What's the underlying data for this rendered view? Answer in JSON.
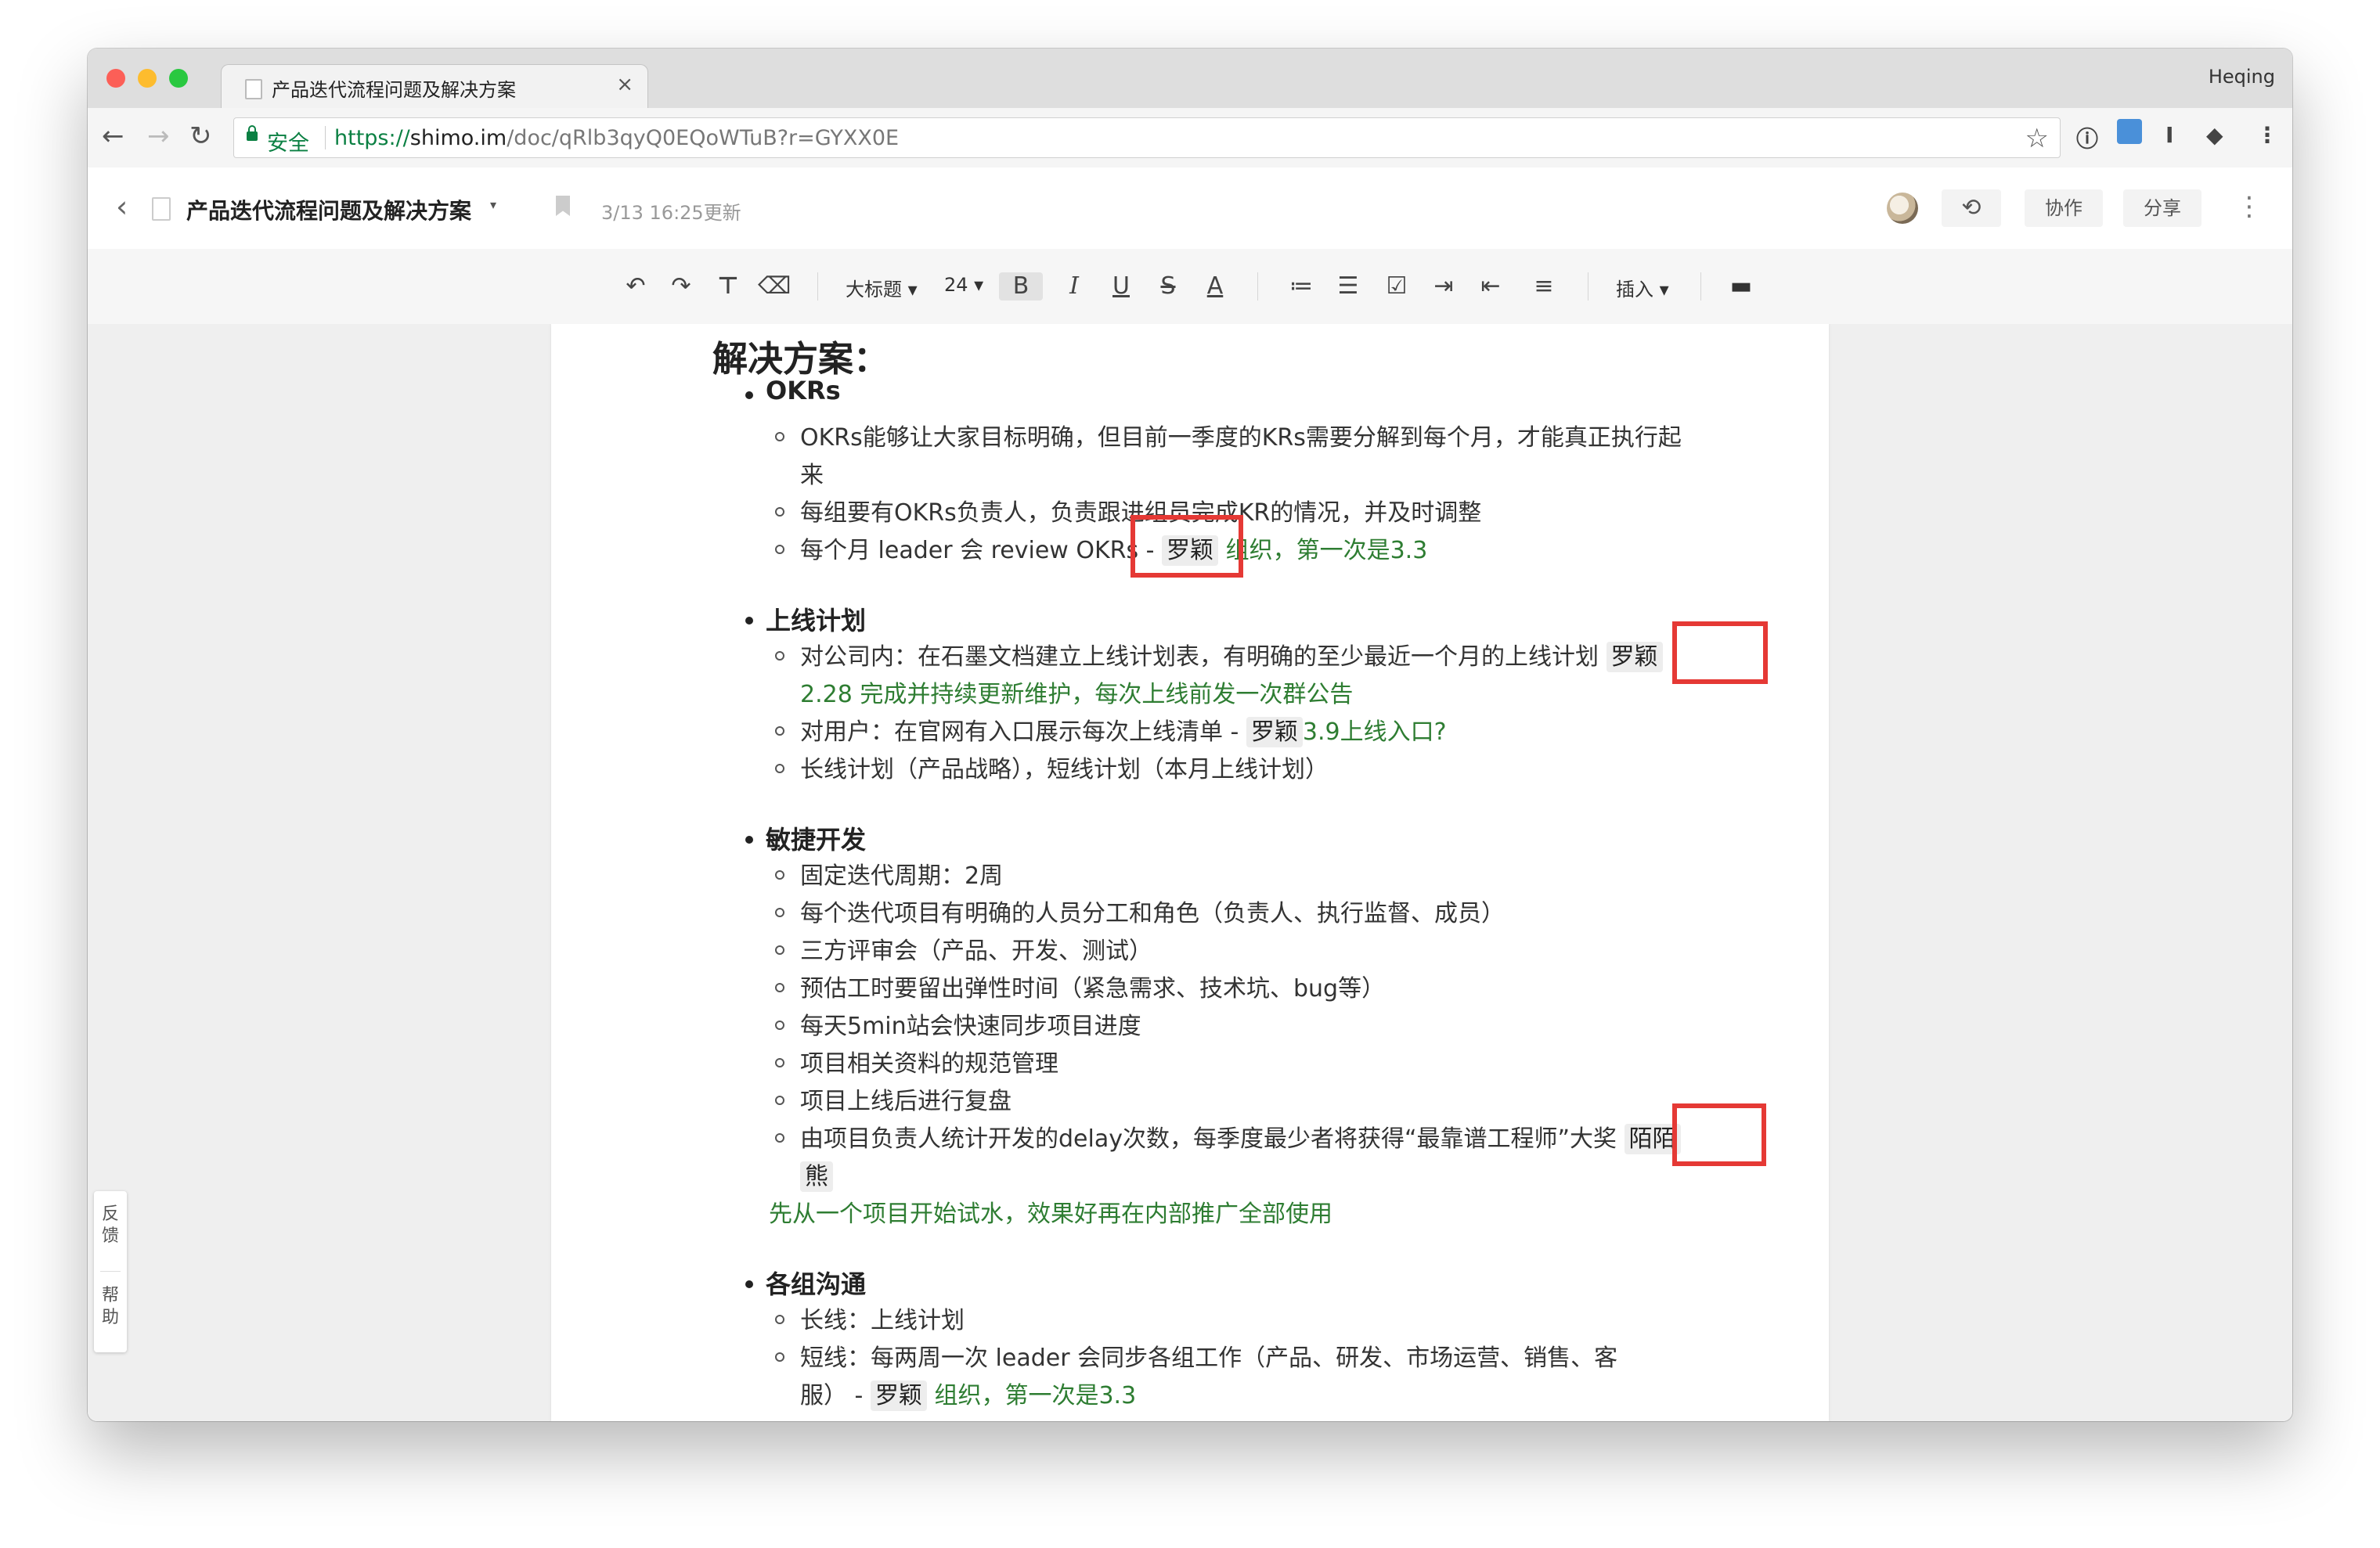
{
  "browser": {
    "tab_title": "产品迭代流程问题及解决方案",
    "tab_close": "×",
    "profile_name": "Heqing",
    "secure_label": "安全",
    "url_proto": "https://",
    "url_host": "shimo.im",
    "url_path": "/doc/qRlb3qyQ0EQoWTuB?r=GYXX0E",
    "back_icon": "←",
    "forward_icon": "→",
    "reload_icon": "↻",
    "star_icon": "☆"
  },
  "app": {
    "back_icon": "‹",
    "doc_title": "产品迭代流程问题及解决方案",
    "title_caret": "▾",
    "updated": "3/13 16:25更新",
    "history_icon": "⟲",
    "collaborate_label": "协作",
    "share_label": "分享",
    "more_icon": "⋮"
  },
  "toolbar": {
    "undo": "↶",
    "redo": "↷",
    "format_painter": "⊤",
    "clear_format": "⌫",
    "heading_style": "大标题 ▾",
    "font_size": "24 ▾",
    "bold": "B",
    "italic": "I",
    "underline": "U",
    "strike": "S",
    "font_color": "A",
    "ordered_list": "≔",
    "bullet_list": "☰",
    "checklist": "☑",
    "indent": "⇥",
    "outdent": "⇤",
    "align": "≡",
    "insert": "插入 ▾",
    "comment": "▬"
  },
  "doc": {
    "heading": "解决方案：",
    "sections": [
      {
        "title": "OKRs",
        "items": [
          "OKRs能够让大家目标明确，但目前一季度的KRs需要分解到每个月，才能真正执行起",
          "来",
          "每组要有OKRs负责人，负责跟进组员完成KR的情况，并及时调整",
          "每个月 leader 会 review OKRs - ",
          "罗颖",
          " 组织，第一次是3.3"
        ]
      },
      {
        "title": "上线计划",
        "items": [
          "对公司内：在石墨文档建立上线计划表，有明确的至少最近一个月的上线计划 ",
          "罗颖",
          "2.28 完成并持续更新维护，每次上线前发一次群公告",
          "对用户：在官网有入口展示每次上线清单 - ",
          "罗颖",
          "3.9上线入口?",
          "长线计划（产品战略），短线计划（本月上线计划）"
        ]
      },
      {
        "title": "敏捷开发",
        "items": [
          "固定迭代周期：2周",
          "每个迭代项目有明确的人员分工和角色（负责人、执行监督、成员）",
          "三方评审会（产品、开发、测试）",
          "预估工时要留出弹性时间（紧急需求、技术坑、bug等）",
          "每天5min站会快速同步项目进度",
          "项目相关资料的规范管理",
          "项目上线后进行复盘",
          "由项目负责人统计开发的delay次数，每季度最少者将获得“最靠谱工程师”大奖 ",
          "陌陌",
          "熊",
          "先从一个项目开始试水，效果好再在内部推广全部使用"
        ]
      },
      {
        "title": "各组沟通",
        "items": [
          "长线：上线计划",
          "短线：每两周一次 leader 会同步各组工作（产品、研发、市场运营、销售、客",
          "服） - ",
          "罗颖",
          " 组织，第一次是3.3"
        ]
      }
    ]
  },
  "side": {
    "feedback": "反馈",
    "help": "帮助"
  },
  "colors": {
    "accent_green": "#2e7d32",
    "highlight_red": "#e53935"
  }
}
